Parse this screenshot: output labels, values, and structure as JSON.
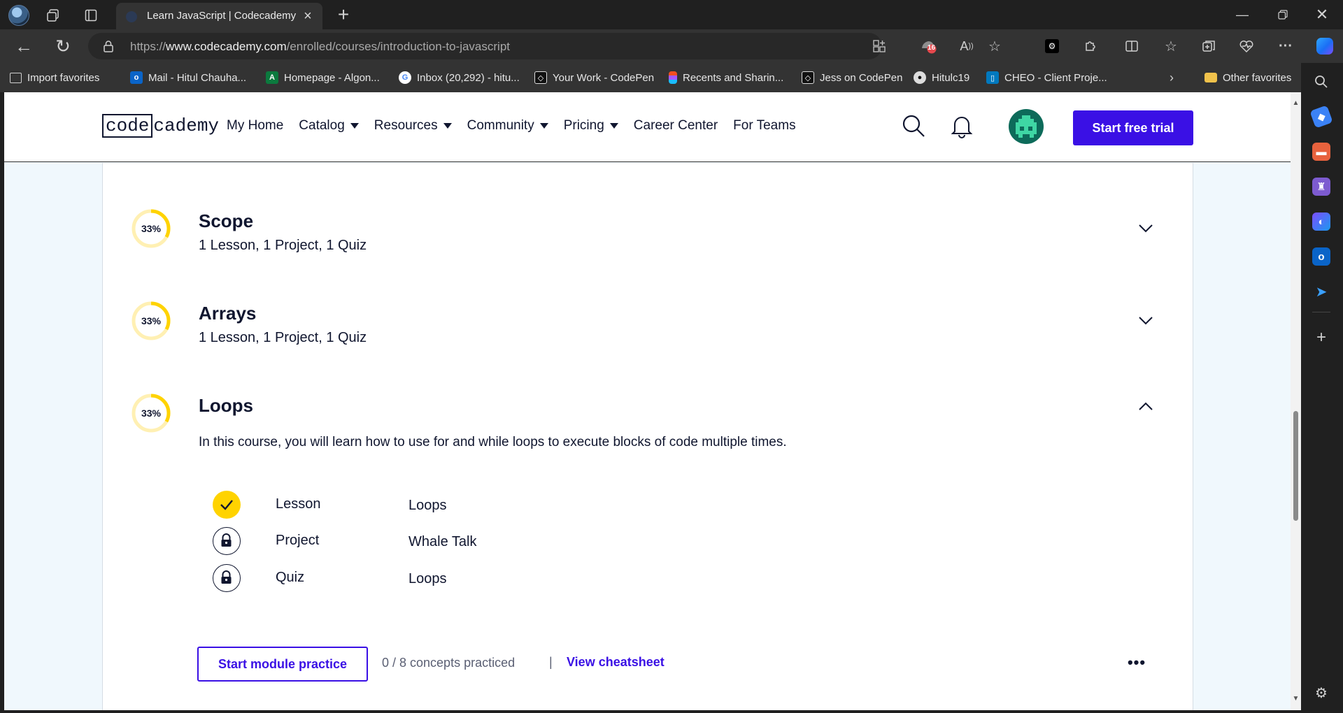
{
  "browser": {
    "tab_title": "Learn JavaScript | Codecademy",
    "url_prefix": "https://",
    "url_domain": "www.codecademy.com",
    "url_path": "/enrolled/courses/introduction-to-javascript",
    "extensions_badge": "16",
    "favorites": [
      {
        "label": "Import favorites",
        "icon": "import-icon",
        "color": "#444444"
      },
      {
        "label": "Mail - Hitul Chauha...",
        "icon": "outlook-icon",
        "color": "#0a64c8"
      },
      {
        "label": "Homepage - Algon...",
        "icon": "algonquin-icon",
        "color": "#0b7a3e"
      },
      {
        "label": "Inbox (20,292) - hitu...",
        "icon": "google-icon",
        "color": "#ffffff"
      },
      {
        "label": "Your Work - CodePen",
        "icon": "codepen-icon",
        "color": "#111111"
      },
      {
        "label": "Recents and Sharin...",
        "icon": "figma-icon",
        "color": "#f24e1e"
      },
      {
        "label": "Jess on CodePen",
        "icon": "codepen-icon",
        "color": "#111111"
      },
      {
        "label": "Hitulc19",
        "icon": "github-icon",
        "color": "#111111"
      },
      {
        "label": "CHEO - Client Proje...",
        "icon": "trello-icon",
        "color": "#0079bf"
      }
    ],
    "other_favorites": "Other favorites"
  },
  "header": {
    "logo_boxed": "code",
    "logo_rest": "cademy",
    "nav": [
      {
        "label": "My Home",
        "dropdown": false
      },
      {
        "label": "Catalog",
        "dropdown": true
      },
      {
        "label": "Resources",
        "dropdown": true
      },
      {
        "label": "Community",
        "dropdown": true
      },
      {
        "label": "Pricing",
        "dropdown": true
      },
      {
        "label": "Career Center",
        "dropdown": false
      },
      {
        "label": "For Teams",
        "dropdown": false
      }
    ],
    "cta_label": "Start free trial"
  },
  "modules": [
    {
      "progress_label": "33%",
      "progress": 0.33,
      "title": "Scope",
      "subtitle": "1 Lesson, 1 Project, 1 Quiz",
      "expanded": false
    },
    {
      "progress_label": "33%",
      "progress": 0.33,
      "title": "Arrays",
      "subtitle": "1 Lesson, 1 Project, 1 Quiz",
      "expanded": false
    },
    {
      "progress_label": "33%",
      "progress": 0.33,
      "title": "Loops",
      "description": "In this course, you will learn how to use for and while loops to execute blocks of code multiple times.",
      "expanded": true,
      "items": [
        {
          "type": "Lesson",
          "name": "Loops",
          "status": "complete"
        },
        {
          "type": "Project",
          "name": "Whale Talk",
          "status": "locked"
        },
        {
          "type": "Quiz",
          "name": "Loops",
          "status": "locked"
        }
      ]
    }
  ],
  "practice": {
    "button_label": "Start module practice",
    "concepts_text": "0 / 8 concepts practiced",
    "separator": "|",
    "cheatsheet_label": "View cheatsheet"
  },
  "colors": {
    "brand": "#3a10e5",
    "ink": "#10162f",
    "progress_yellow": "#ffd300",
    "progress_track": "#fff0b3",
    "page_bg": "#f0f8fd"
  }
}
